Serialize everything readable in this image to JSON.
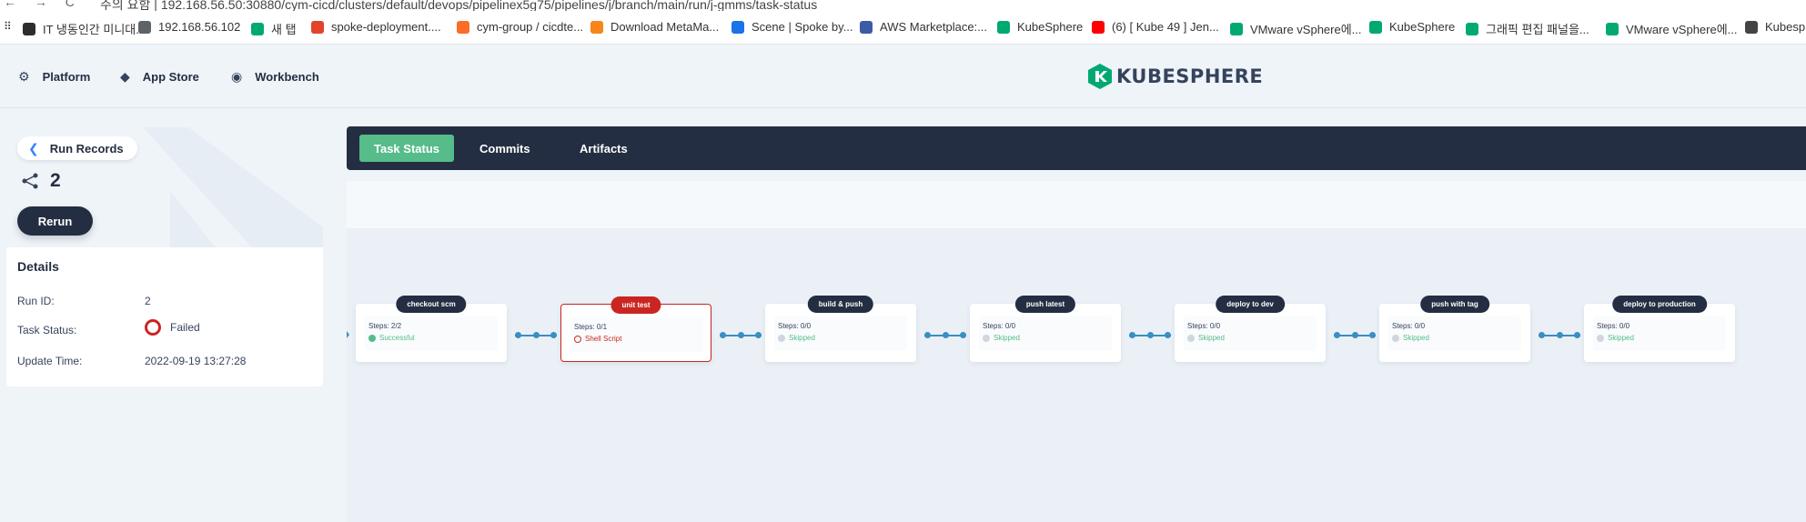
{
  "browser": {
    "nav_glyphs": "← → C",
    "url": "주의 요함  |  192.168.56.50:30880/cym-cicd/clusters/default/devops/pipelinex5g75/pipelines/j/branch/main/run/j-gmms/task-status",
    "bookmarks": [
      {
        "label": "IT 냉동인간 미니대...",
        "color": "#2d2d2d"
      },
      {
        "label": "192.168.56.102",
        "color": "#5f6368"
      },
      {
        "label": "새 탭",
        "color": "#00a971"
      },
      {
        "label": "spoke-deployment....",
        "color": "#e24329"
      },
      {
        "label": "cym-group / cicdte...",
        "color": "#fc6d26"
      },
      {
        "label": "Download MetaMa...",
        "color": "#f6851b"
      },
      {
        "label": "Scene | Spoke by...",
        "color": "#1a73e8"
      },
      {
        "label": "AWS Marketplace:...",
        "color": "#3b5ba5"
      },
      {
        "label": "KubeSphere",
        "color": "#00a971"
      },
      {
        "label": "(6) [ Kube 49 ] Jen...",
        "color": "#ff0000"
      },
      {
        "label": "VMware vSphere에...",
        "color": "#00a971"
      },
      {
        "label": "KubeSphere",
        "color": "#00a971"
      },
      {
        "label": "그래픽 편집 패널을...",
        "color": "#00a971"
      },
      {
        "label": "VMware vSphere에...",
        "color": "#00a971"
      },
      {
        "label": "Kubesph",
        "color": "#444444"
      }
    ]
  },
  "topnav": {
    "platform": "Platform",
    "app_store": "App Store",
    "workbench": "Workbench",
    "logo_text": "KUBESPHERE",
    "brand_color": "#00a971"
  },
  "left": {
    "back_label": "Run Records",
    "run_number": "2",
    "rerun_label": "Rerun",
    "details_title": "Details",
    "details": [
      {
        "key": "Run ID:",
        "value": "2"
      },
      {
        "key": "Task Status:",
        "value": "Failed"
      },
      {
        "key": "Update Time:",
        "value": "2022-09-19 13:27:28"
      }
    ]
  },
  "tabs": [
    {
      "label": "Task Status",
      "active": true
    },
    {
      "label": "Commits",
      "active": false
    },
    {
      "label": "Artifacts",
      "active": false
    }
  ],
  "pipeline": [
    {
      "name": "checkout scm",
      "steps": "Steps: 2/2",
      "status": "Successful",
      "state": "success"
    },
    {
      "name": "unit test",
      "steps": "Steps: 0/1",
      "status": "Shell Script",
      "state": "failed"
    },
    {
      "name": "build & push",
      "steps": "Steps: 0/0",
      "status": "Skipped",
      "state": "skipped"
    },
    {
      "name": "push latest",
      "steps": "Steps: 0/0",
      "status": "Skipped",
      "state": "skipped"
    },
    {
      "name": "deploy to dev",
      "steps": "Steps: 0/0",
      "status": "Skipped",
      "state": "skipped"
    },
    {
      "name": "push with tag",
      "steps": "Steps: 0/0",
      "status": "Skipped",
      "state": "skipped"
    },
    {
      "name": "deploy to production",
      "steps": "Steps: 0/0",
      "status": "Skipped",
      "state": "skipped"
    }
  ],
  "colors": {
    "success": "#55bc8a",
    "failed": "#ca2621",
    "skipped_dot": "#d0d6de",
    "skipped_text": "#55bc8a"
  }
}
